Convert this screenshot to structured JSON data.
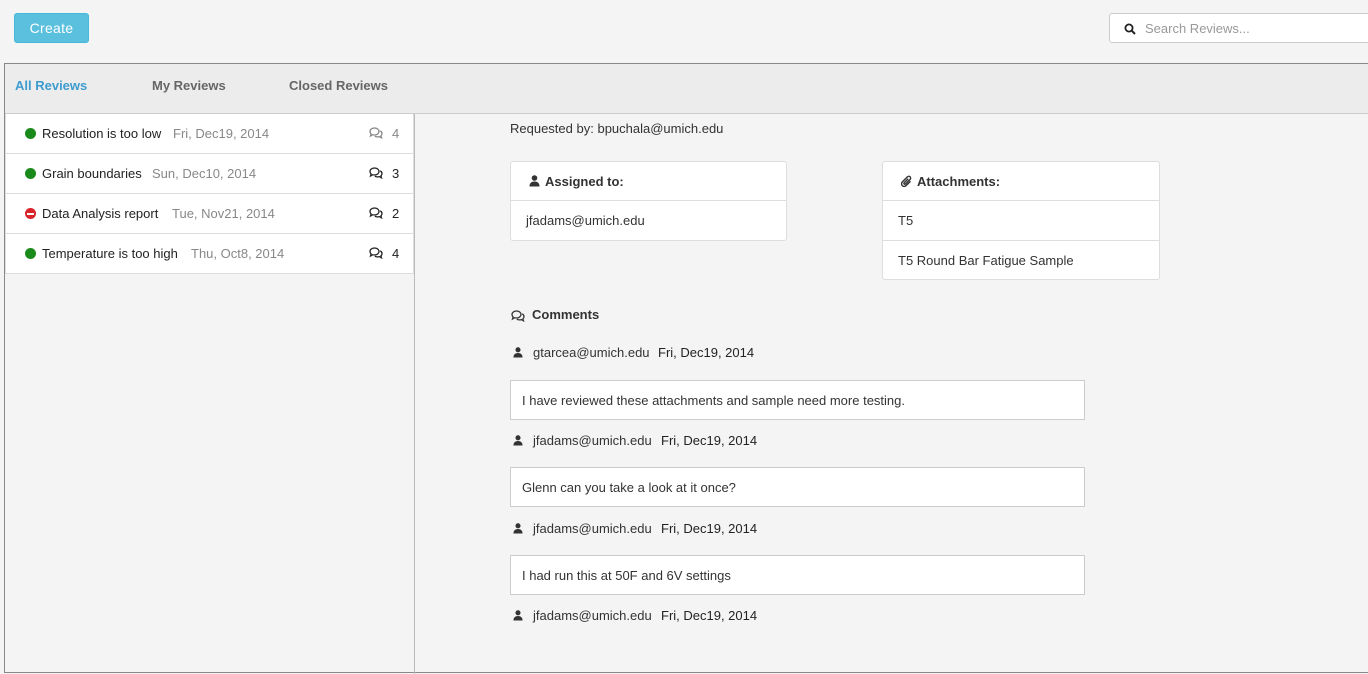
{
  "toolbar": {
    "create_label": "Create"
  },
  "search": {
    "placeholder": "Search Reviews..."
  },
  "tabs": [
    {
      "label": "All Reviews",
      "active": true
    },
    {
      "label": "My Reviews",
      "active": false
    },
    {
      "label": "Closed Reviews",
      "active": false
    }
  ],
  "reviews": [
    {
      "title": "Resolution is too low",
      "date": "Fri, Dec19, 2014",
      "count": "4",
      "status": "open"
    },
    {
      "title": "Grain boundaries",
      "date": "Sun, Dec10, 2014",
      "count": "3",
      "status": "open"
    },
    {
      "title": "Data Analysis report",
      "date": "Tue, Nov21, 2014",
      "count": "2",
      "status": "blocked"
    },
    {
      "title": "Temperature is too high",
      "date": "Thu, Oct8, 2014",
      "count": "4",
      "status": "open"
    }
  ],
  "detail": {
    "requested_label": "Requested by:",
    "requested_by": "bpuchala@umich.edu",
    "assigned": {
      "label": "Assigned to:",
      "value": "jfadams@umich.edu"
    },
    "attachments": {
      "label": "Attachments:",
      "items": [
        "T5",
        "T5 Round Bar Fatigue Sample"
      ]
    },
    "comments_label": "Comments",
    "comments": [
      {
        "author": "gtarcea@umich.edu",
        "date": "Fri, Dec19, 2014",
        "text": "I have reviewed these attachments and sample need more testing."
      },
      {
        "author": "jfadams@umich.edu",
        "date": "Fri, Dec19, 2014",
        "text": "Glenn can you take a look at it once?"
      },
      {
        "author": "jfadams@umich.edu",
        "date": "Fri, Dec19, 2014",
        "text": "I had run this at 50F and 6V settings"
      },
      {
        "author": "jfadams@umich.edu",
        "date": "Fri, Dec19, 2014",
        "text": ""
      }
    ]
  },
  "colors": {
    "accent": "#3d9ccf",
    "button": "#5bc0de",
    "status_open": "#1a8a1a",
    "status_blocked": "#d9232a"
  },
  "icons": {
    "search": "search-icon",
    "comment": "comments-icon",
    "user": "user-icon",
    "attachment": "paperclip-icon"
  }
}
